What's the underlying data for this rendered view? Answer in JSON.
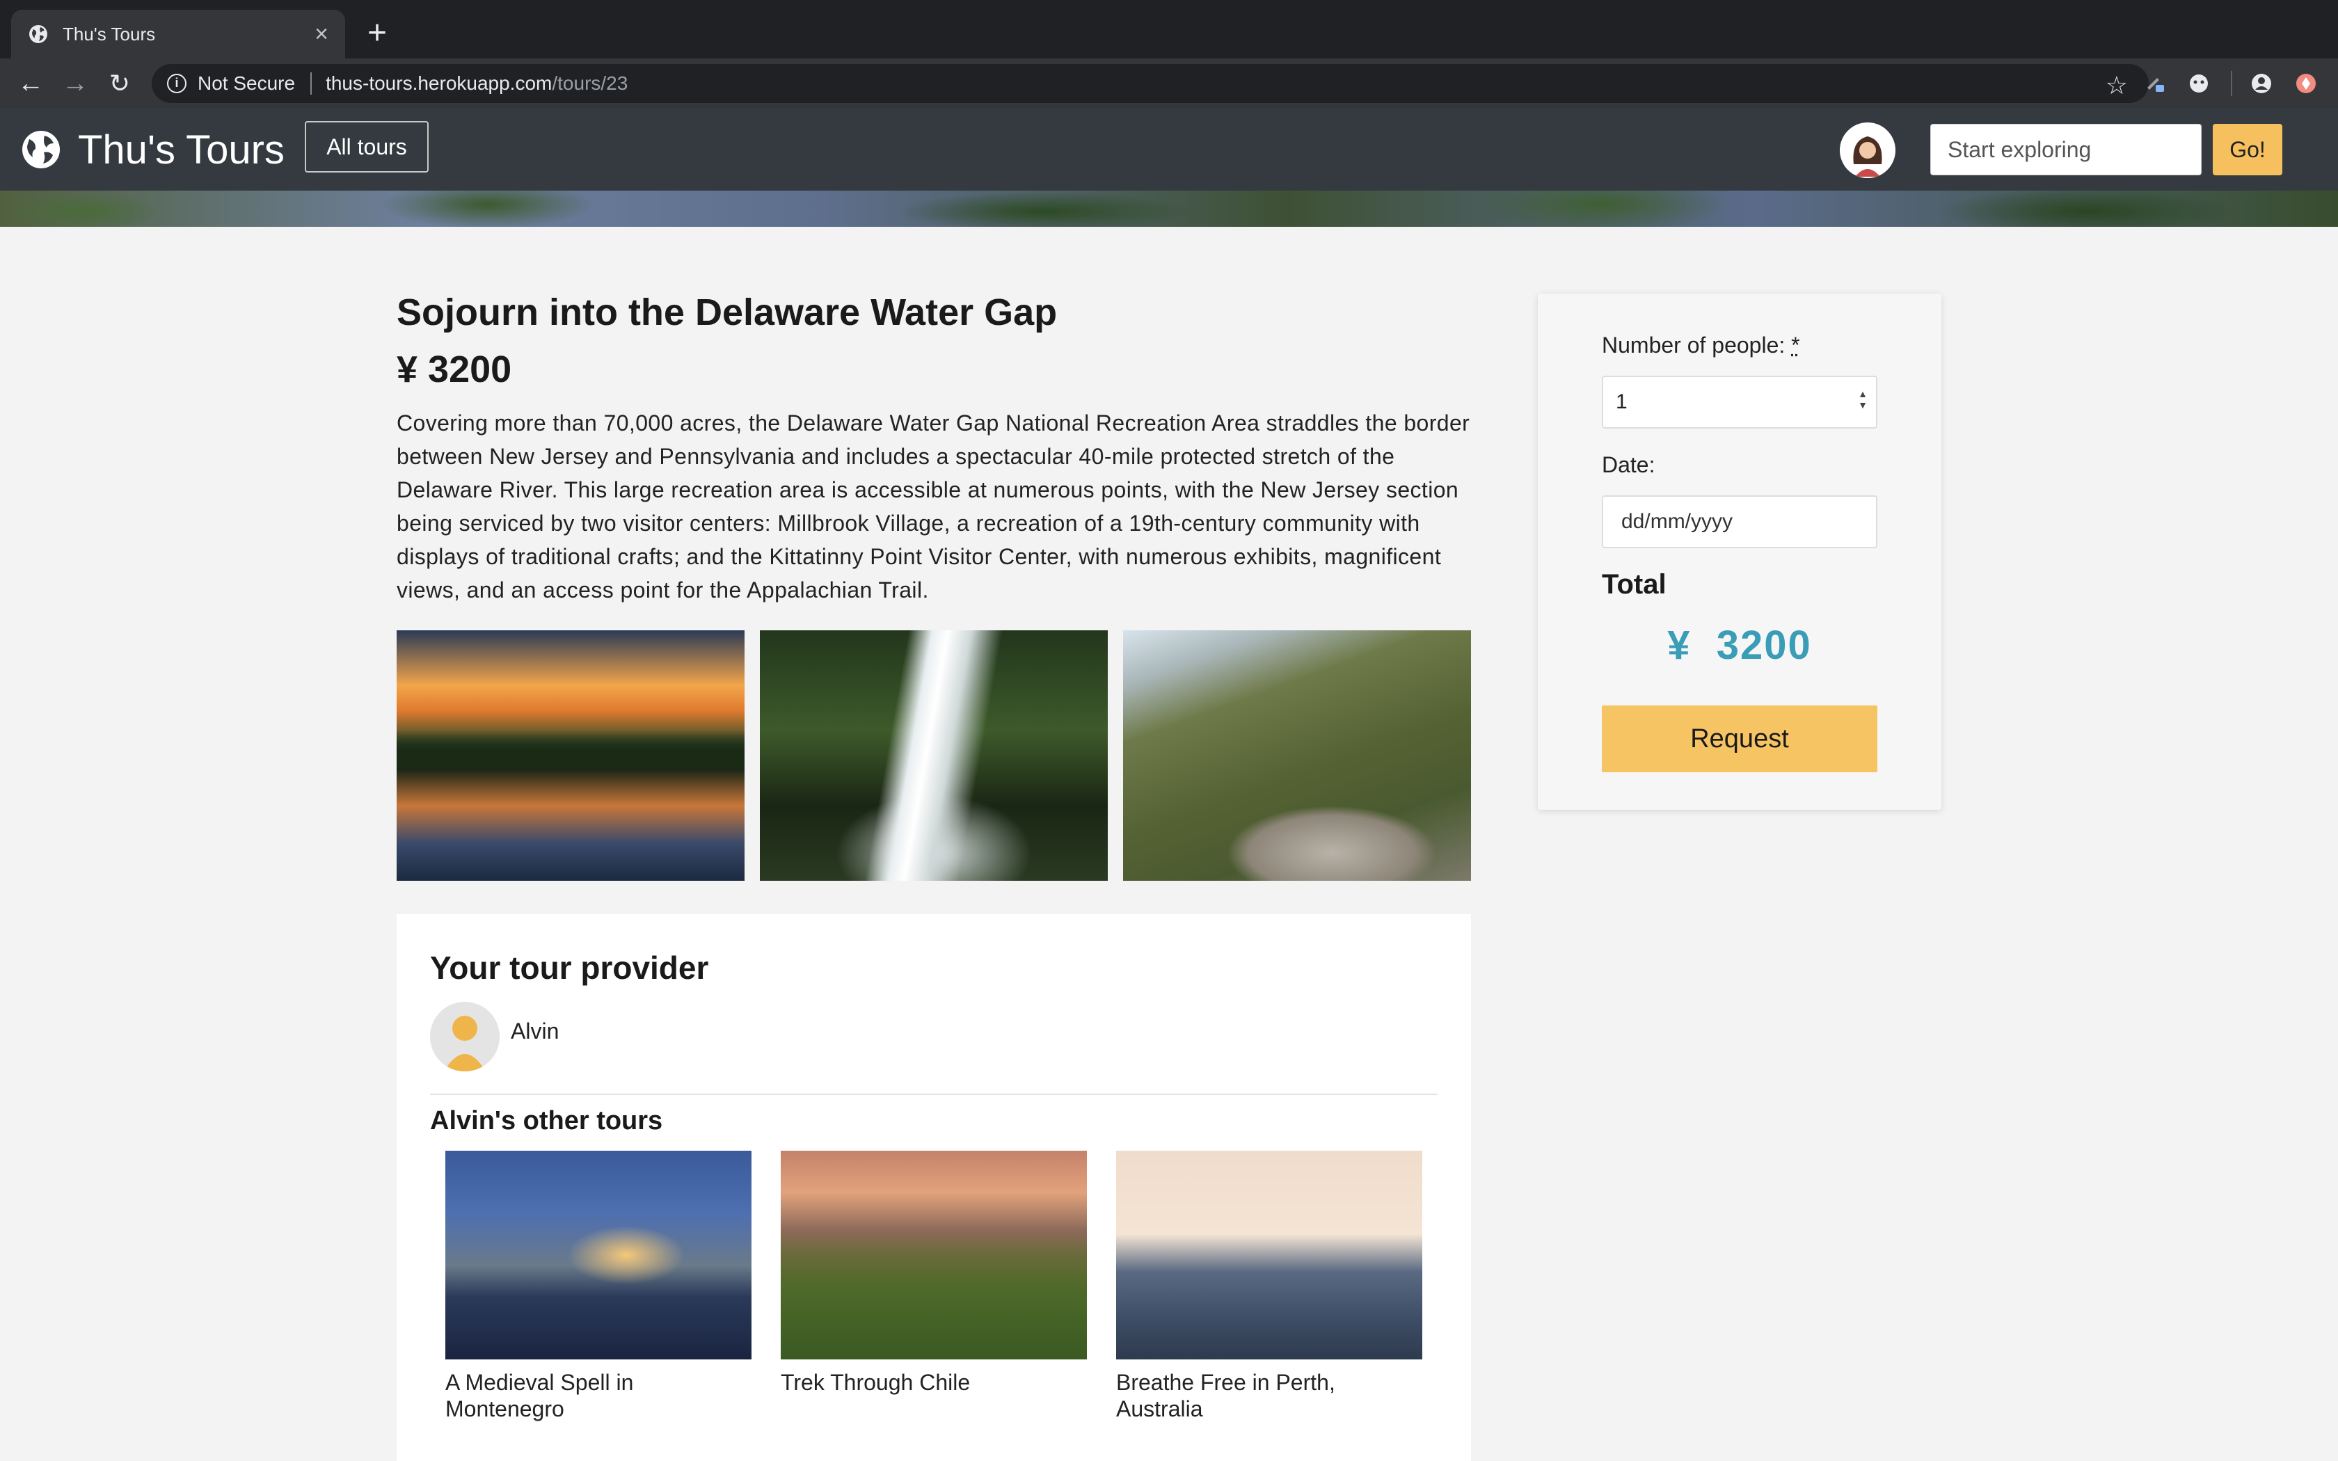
{
  "browser": {
    "tab_title": "Thu's Tours",
    "tab_close": "×",
    "new_tab": "+",
    "security_label": "Not Secure",
    "url_host": "thus-tours.herokuapp.com",
    "url_path": "/tours/23"
  },
  "site_nav": {
    "brand": "Thu's Tours",
    "all_tours": "All tours",
    "search_placeholder": "Start exploring",
    "go_label": "Go!"
  },
  "tour": {
    "title": "Sojourn into the Delaware Water Gap",
    "price": "¥ 3200",
    "description": "Covering more than 70,000 acres, the Delaware Water Gap National Recreation Area straddles the border between New Jersey and Pennsylvania and includes a spectacular 40-mile protected stretch of the Delaware River. This large recreation area is accessible at numerous points, with the New Jersey section being serviced by two visitor centers: Millbrook Village, a recreation of a 19th-century community with displays of traditional crafts; and the Kittatinny Point Visitor Center, with numerous exhibits, magnificent views, and an access point for the Appalachian Trail."
  },
  "provider": {
    "heading": "Your tour provider",
    "name": "Alvin",
    "other_heading": "Alvin's other tours",
    "other_tours": [
      {
        "name": "A Medieval Spell in Montenegro"
      },
      {
        "name": "Trek Through Chile"
      },
      {
        "name": "Breathe Free in Perth, Australia"
      }
    ]
  },
  "booking": {
    "people_label": "Number of people: ",
    "required_mark": "*",
    "people_value": "1",
    "date_label": "Date:",
    "date_placeholder": "dd/mm/yyyy",
    "total_label": "Total",
    "total_value": "¥  3200",
    "request_label": "Request"
  },
  "colors": {
    "navbar": "#343a40",
    "accent_yellow": "#f7c464",
    "total_blue": "#3a9db8"
  }
}
